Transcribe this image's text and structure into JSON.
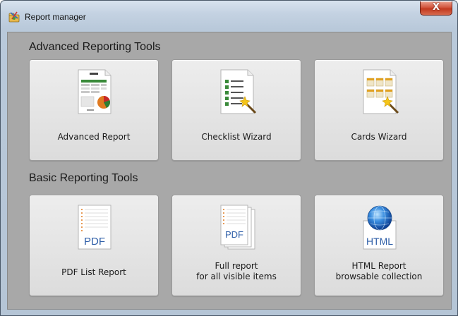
{
  "window": {
    "title": "Report manager",
    "close_glyph": "X"
  },
  "sections": {
    "advanced": {
      "title": "Advanced Reporting Tools",
      "tiles": [
        {
          "label": "Advanced Report"
        },
        {
          "label": "Checklist Wizard"
        },
        {
          "label": "Cards Wizard"
        }
      ]
    },
    "basic": {
      "title": "Basic Reporting Tools",
      "tiles": [
        {
          "label": "PDF List Report"
        },
        {
          "label_line1": "Full report",
          "label_line2": "for all visible items"
        },
        {
          "label_line1": "HTML Report",
          "label_line2": "browsable collection"
        }
      ]
    }
  },
  "icons": {
    "title": "report-manager-app-icon",
    "advanced_report": "advanced-report-document-icon",
    "checklist_wizard": "checklist-wand-icon",
    "cards_wizard": "cards-wand-icon",
    "pdf_list": "pdf-document-icon",
    "full_report": "pdf-stack-icon",
    "html_report": "html-globe-document-icon"
  },
  "icon_text": {
    "pdf": "PDF",
    "pdf_stack": "PDF",
    "html": "HTML"
  },
  "colors": {
    "close_button": "#c8432a",
    "content_background": "#a8a8a8",
    "tile_background": "#e4e4e4",
    "pdf_text": "#2f5fa8"
  }
}
